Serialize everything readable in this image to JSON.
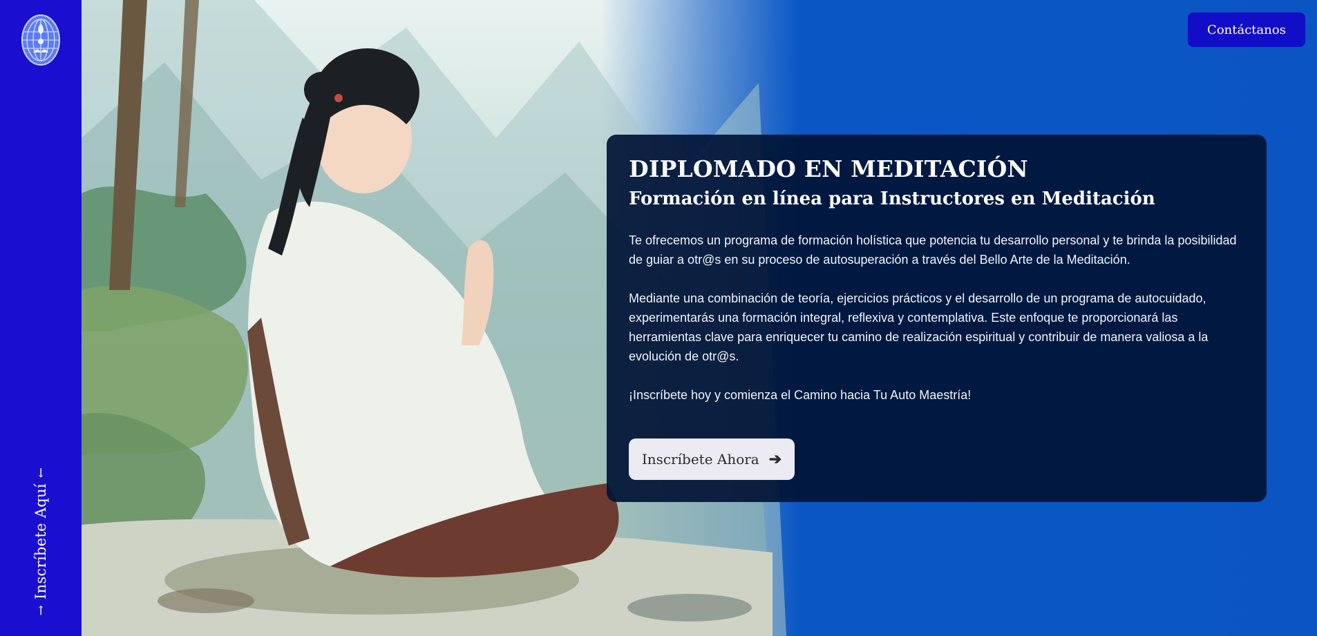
{
  "sidebar": {
    "logo_icon": "lotus-globe-icon",
    "cta_label": "Inscríbete Aquí",
    "cta_arrow_left": "→",
    "cta_arrow_right": "←"
  },
  "header": {
    "contact_label": "Contáctanos"
  },
  "hero": {
    "illustration": "meditating-woman-mountains-illustration"
  },
  "card": {
    "title": "DIPLOMADO EN MEDITACIÓN",
    "subtitle": "Formación en línea para Instructores en Meditación",
    "paragraph1": "Te ofrecemos un programa de formación holística que potencia tu desarrollo personal y te brinda la posibilidad de guiar a otr@s en su proceso de autosuperación a través del Bello Arte de la Meditación.",
    "paragraph2": "Mediante una combinación de teoría, ejercicios prácticos y el desarrollo de un programa de autocuidado, experimentarás una formación integral, reflexiva y contemplativa. Este enfoque te proporcionará las herramientas clave para enriquecer tu camino de realización espiritual y contribuir de manera valiosa a la evolución de otr@s.",
    "paragraph3": "¡Inscríbete hoy y comienza el Camino hacia Tu Auto Maestría!",
    "button_label": "Inscríbete Ahora",
    "button_arrow": "➔"
  },
  "colors": {
    "sidebar": "#1a0fd0",
    "background": "#0a57c4",
    "card": "#011437",
    "contact_button": "#120ec8",
    "enroll_button": "#eceaf2"
  }
}
